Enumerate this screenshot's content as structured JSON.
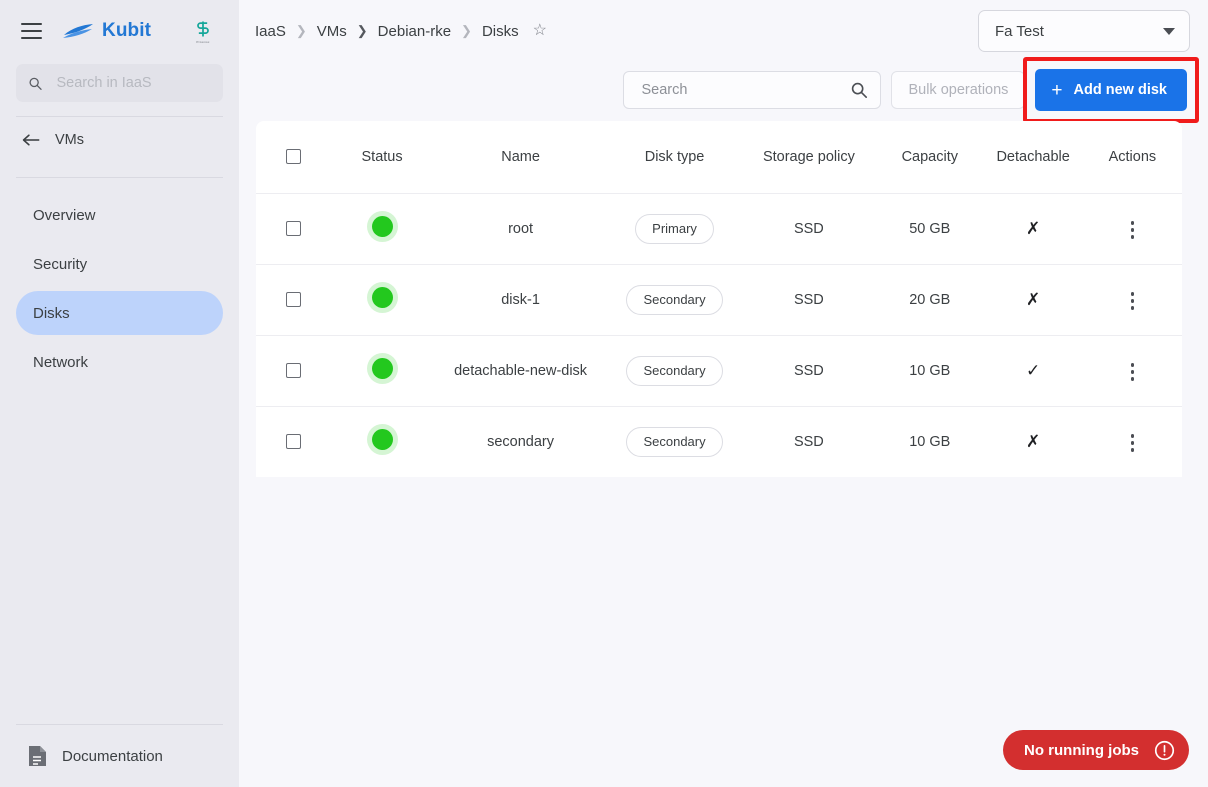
{
  "app": {
    "brand_name": "Kubit",
    "partner_sub_label": "Proxmox"
  },
  "sidebar": {
    "search_placeholder": "Search in IaaS",
    "search_value": "",
    "back_label": "VMs",
    "items": [
      {
        "label": "Overview",
        "active": false
      },
      {
        "label": "Security",
        "active": false
      },
      {
        "label": "Disks",
        "active": true
      },
      {
        "label": "Network",
        "active": false
      }
    ],
    "documentation_label": "Documentation"
  },
  "header": {
    "breadcrumb": [
      "IaaS",
      "VMs",
      "Debian-rke",
      "Disks"
    ],
    "env_selector_value": "Fa Test"
  },
  "toolbar": {
    "search_placeholder": "Search",
    "search_value": "",
    "bulk_label": "Bulk operations",
    "add_label": "Add new disk",
    "add_color": "#1a73e8",
    "highlight_color": "#f01b1b"
  },
  "table": {
    "columns": [
      "Status",
      "Name",
      "Disk type",
      "Storage policy",
      "Capacity",
      "Detachable",
      "Actions"
    ],
    "rows": [
      {
        "status": "running",
        "name": "root",
        "disk_type": "Primary",
        "storage_policy": "SSD",
        "capacity": "50 GB",
        "detachable": "✗"
      },
      {
        "status": "running",
        "name": "disk-1",
        "disk_type": "Secondary",
        "storage_policy": "SSD",
        "capacity": "20 GB",
        "detachable": "✗"
      },
      {
        "status": "running",
        "name": "detachable-new-disk",
        "disk_type": "Secondary",
        "storage_policy": "SSD",
        "capacity": "10 GB",
        "detachable": "✓"
      },
      {
        "status": "running",
        "name": "secondary",
        "disk_type": "Secondary",
        "storage_policy": "SSD",
        "capacity": "10 GB",
        "detachable": "✗"
      }
    ],
    "status_color": "#23c81e"
  },
  "jobs": {
    "label": "No running jobs",
    "color": "#d32f2f"
  }
}
